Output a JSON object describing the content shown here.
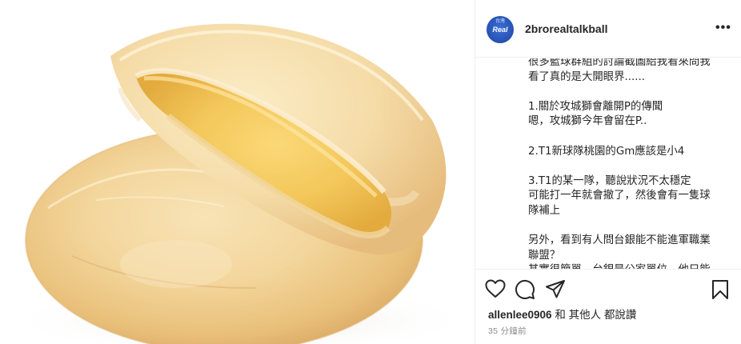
{
  "post": {
    "author": {
      "username": "2brorealtalkball",
      "avatar_top": "台灣",
      "avatar_text": "Real"
    },
    "more_label": "•••",
    "caption": "很多籃球群組的討論截圖給我看來問我\n看了真的是大開眼界......\n\n1.關於攻城獅會離開P的傳聞\n嗯，攻城獅今年會留在P..\n\n2.T1新球隊桃園的Gm應該是小4\n\n3.T1的某一隊，聽說狀況不太穩定\n可能打一年就會撤了，然後會有一隻球\n隊補上\n\n另外，看到有人問台銀能不能進軍職業\n聯盟？\n其實很簡單，台銀是公家單位，他只能",
    "likes": {
      "user": "allenlee0906",
      "suffix": " 和 其他人 都說讚"
    },
    "time_ago": "35 分鐘前"
  },
  "icons": {
    "like": "heart-icon",
    "comment": "comment-icon",
    "share": "share-icon",
    "save": "bookmark-icon",
    "more": "more-options-icon"
  },
  "colors": {
    "text": "#262626",
    "secondary": "#8e8e8e",
    "border": "#efefef",
    "avatar": "#2a55b8"
  }
}
